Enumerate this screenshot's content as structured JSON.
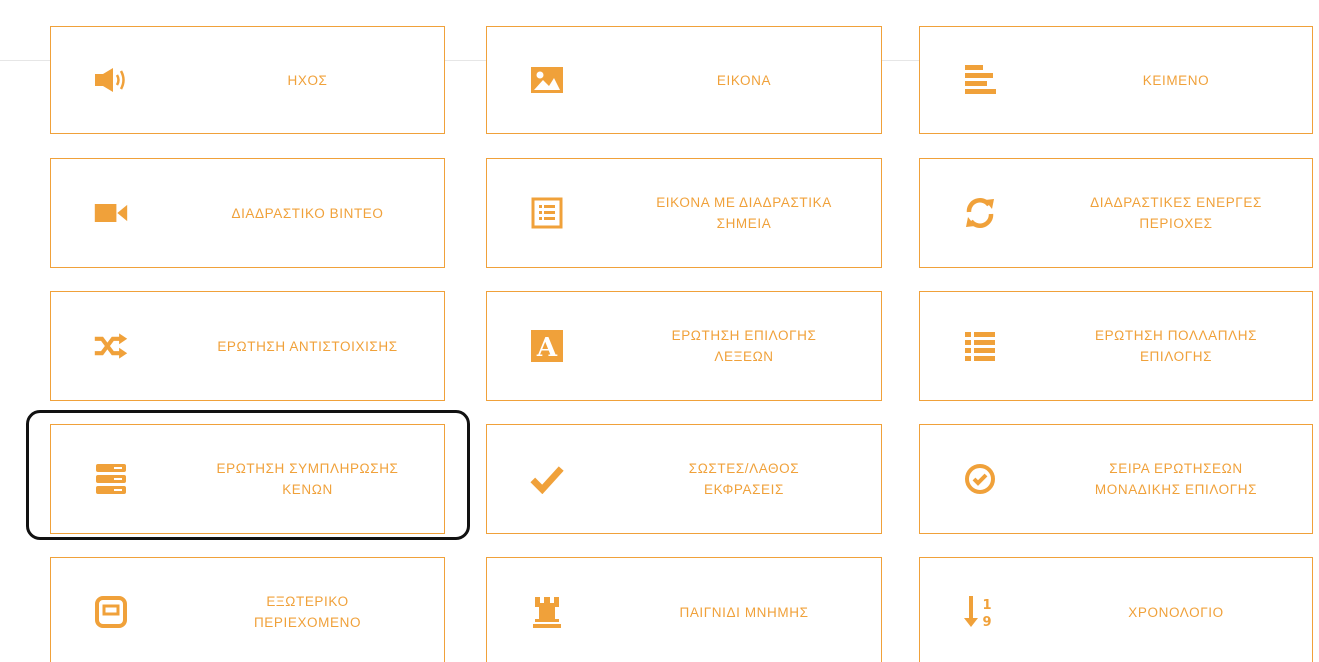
{
  "accent_color": "#f0a13a",
  "highlight_color": "#111111",
  "tiles": [
    {
      "label": "ΗΧΟΣ",
      "icon": "speaker-icon"
    },
    {
      "label": "ΕΙΚΟΝΑ",
      "icon": "image-icon"
    },
    {
      "label": "ΚΕΙΜΕΝΟ",
      "icon": "text-align-icon"
    },
    {
      "label": "ΔΙΑΔΡΑΣΤΙΚΟ ΒΙΝΤΕΟ",
      "icon": "video-camera-icon"
    },
    {
      "label": "ΕΙΚΟΝΑ ΜΕ ΔΙΑΔΡΑΣΤΙΚΑ\nΣΗΜΕΙΑ",
      "icon": "list-box-icon"
    },
    {
      "label": "ΔΙΑΔΡΑΣΤΙΚΕΣ ΕΝΕΡΓΕΣ\nΠΕΡΙΟΧΕΣ",
      "icon": "refresh-icon"
    },
    {
      "label": "ΕΡΩΤΗΣΗ ΑΝΤΙΣΤΟΙΧΙΣΗΣ",
      "icon": "shuffle-icon"
    },
    {
      "label": "ΕΡΩΤΗΣΗ ΕΠΙΛΟΓΗΣ\nΛΕΞΕΩΝ",
      "icon": "letter-a-icon"
    },
    {
      "label": "ΕΡΩΤΗΣΗ ΠΟΛΛΑΠΛΗΣ\nΕΠΙΛΟΓΗΣ",
      "icon": "list-icon"
    },
    {
      "label": "ΕΡΩΤΗΣΗ ΣΥΜΠΛΗΡΩΣΗΣ\nΚΕΝΩΝ",
      "icon": "server-icon"
    },
    {
      "label": "ΣΩΣΤΕΣ/ΛΑΘΟΣ\nΕΚΦΡΑΣΕΙΣ",
      "icon": "checkmark-icon"
    },
    {
      "label": "ΣΕΙΡΑ ΕΡΩΤΗΣΕΩΝ\nΜΟΝΑΔΙΚΗΣ ΕΠΙΛΟΓΗΣ",
      "icon": "check-circle-icon"
    },
    {
      "label": "ΕΞΩΤΕΡΙΚΟ\nΠΕΡΙΕΧΟΜΕΝΟ",
      "icon": "embed-box-icon"
    },
    {
      "label": "ΠΑΙΓΝΙΔΙ ΜΝΗΜΗΣ",
      "icon": "chess-rook-icon"
    },
    {
      "label": "ΧΡΟΝΟΛΟΓΙΟ",
      "icon": "sort-numeric-icon"
    }
  ]
}
